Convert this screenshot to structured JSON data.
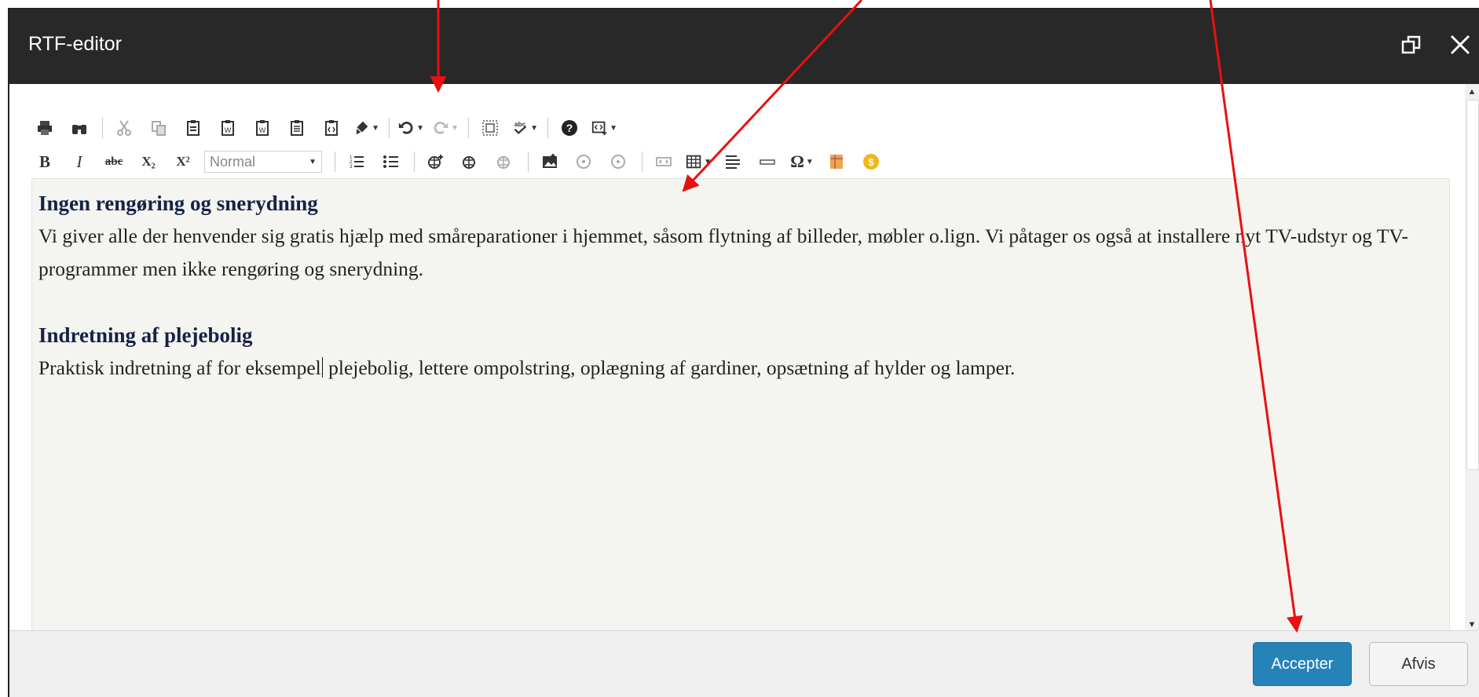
{
  "dialog": {
    "title": "RTF-editor"
  },
  "toolbar": {
    "row1": [
      "print-icon",
      "find-icon",
      "cut-icon",
      "copy-icon",
      "paste-icon",
      "paste-word-icon",
      "paste-word-alt-icon",
      "paste-text-icon",
      "paste-template-icon",
      "format-brush-icon",
      "undo-icon",
      "redo-icon",
      "select-all-icon",
      "spellcheck-icon",
      "help-icon",
      "insert-snippet-icon"
    ],
    "format_value": "Normal",
    "bold_label": "B",
    "italic_label": "I",
    "strike_label": "abc",
    "subscript_label": "X₂",
    "superscript_label": "X²",
    "omega_label": "Ω",
    "spell_label": "abc"
  },
  "editor": {
    "heading1": "Ingen rengøring og snerydning",
    "para1": "Vi giver alle der henvender sig gratis hjælp med småreparationer i hjemmet, såsom flytning af billeder, møbler o.lign. Vi påtager os også at installere nyt TV-udstyr og TV-programmer men ikke rengøring og snerydning.",
    "heading2": "Indretning af plejebolig",
    "para2_before_caret": "Praktisk indretning af for eksempel",
    "para2_after_caret": " plejebolig, lettere ompolstring, oplægning af gardiner, opsætning af hylder og lamper."
  },
  "footer": {
    "accept_label": "Accepter",
    "reject_label": "Afvis"
  },
  "colors": {
    "titlebar": "#282828",
    "accent": "#2683b8",
    "annotation": "#e81010",
    "heading": "#172146"
  }
}
